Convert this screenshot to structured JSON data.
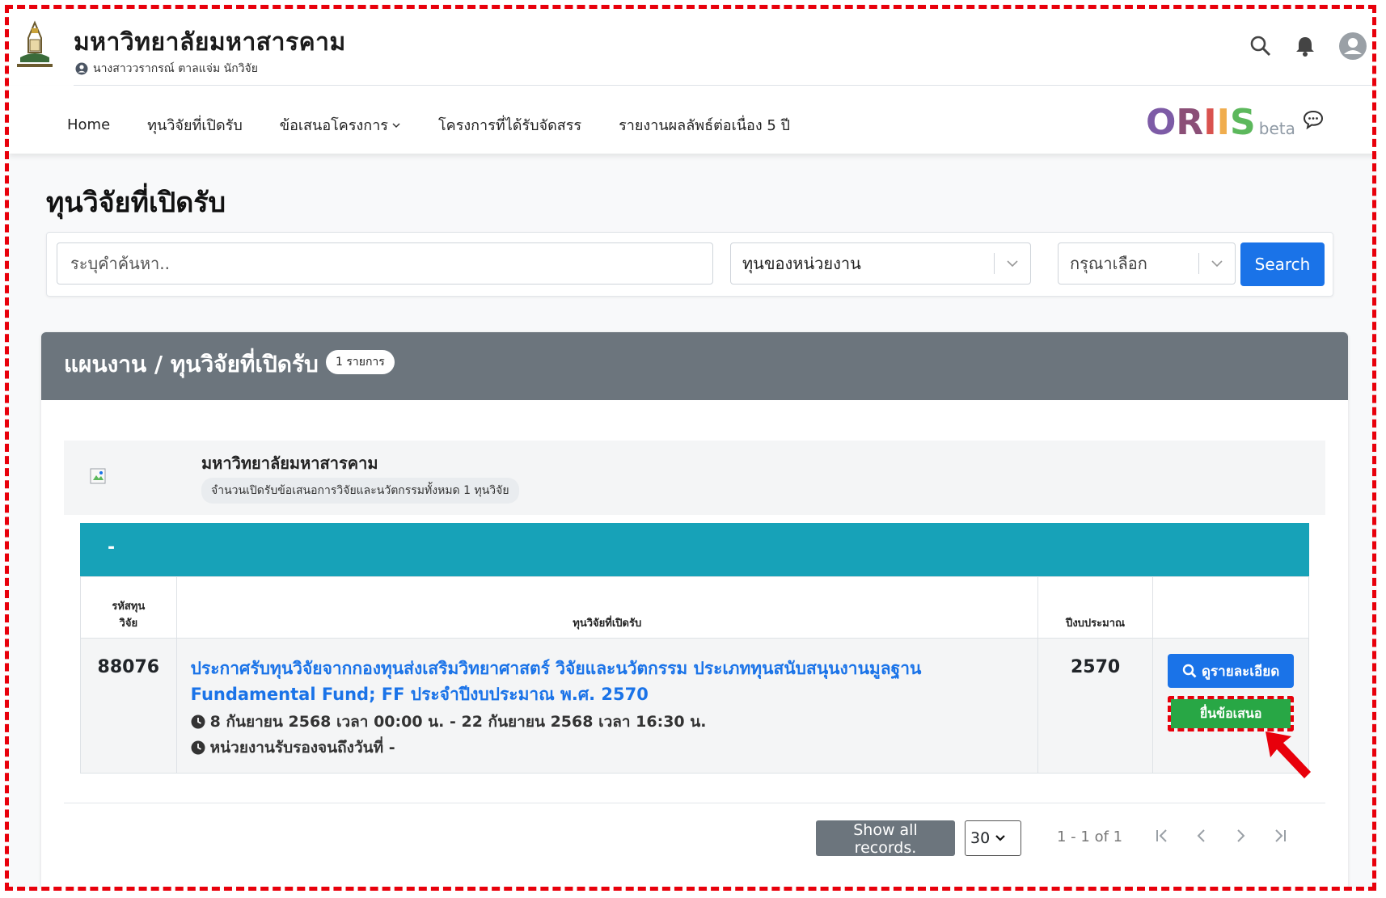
{
  "header": {
    "university_name": "มหาวิทยาลัยมหาสารคาม",
    "user_line": "นางสาววรากรณ์ ตาลแจ่ม นักวิจัย"
  },
  "nav": {
    "items": [
      "Home",
      "ทุนวิจัยที่เปิดรับ",
      "ข้อเสนอโครงการ",
      "โครงการที่ได้รับจัดสรร",
      "รายงานผลลัพธ์ต่อเนื่อง 5 ปี"
    ],
    "brand": {
      "o": "O",
      "r": "R",
      "i1": "I",
      "i2": "I",
      "s": "S",
      "beta": "beta"
    }
  },
  "page": {
    "title": "ทุนวิจัยที่เปิดรับ"
  },
  "search": {
    "placeholder": "ระบุคำค้นหา..",
    "agency_select": "ทุนของหน่วยงาน",
    "choose_select": "กรุณาเลือก",
    "button": "Search"
  },
  "panel": {
    "title": "แผนงาน / ทุนวิจัยที่เปิดรับ",
    "badge": "1 รายการ",
    "org_name": "มหาวิทยาลัยมหาสารคาม",
    "org_summary": "จำนวนเปิดรับข้อเสนอการวิจัยและนวัตกรรมทั้งหมด 1 ทุนวิจัย",
    "group_label": "-"
  },
  "table": {
    "headers": {
      "code_line1": "รหัสทุน",
      "code_line2": "วิจัย",
      "name": "ทุนวิจัยที่เปิดรับ",
      "year": "ปีงบประมาณ"
    },
    "rows": [
      {
        "code": "88076",
        "title": "ประกาศรับทุนวิจัยจากกองทุนส่งเสริมวิทยาศาสตร์ วิจัยและนวัตกรรม ประเภททุนสนับสนุนงานมูลฐาน Fundamental Fund; FF ประจำปีงบประมาณ พ.ศ. 2570",
        "period": "8 กันยายน 2568 เวลา 00:00 น. - 22 กันยายน 2568 เวลา 16:30 น.",
        "certify": "หน่วยงานรับรองจนถึงวันที่ -",
        "year": "2570",
        "detail_button": "ดูรายละเอียด",
        "submit_button": "ยื่นข้อเสนอ"
      }
    ]
  },
  "pager": {
    "show_all": "Show all records.",
    "per_page": "30",
    "range": "1 - 1 of 1"
  },
  "colors": {
    "accent": "#1a73e8",
    "teal": "#17a2b8",
    "header_gray": "#6c757d",
    "submit_green": "#28a745",
    "highlight_red": "#e8000b"
  }
}
